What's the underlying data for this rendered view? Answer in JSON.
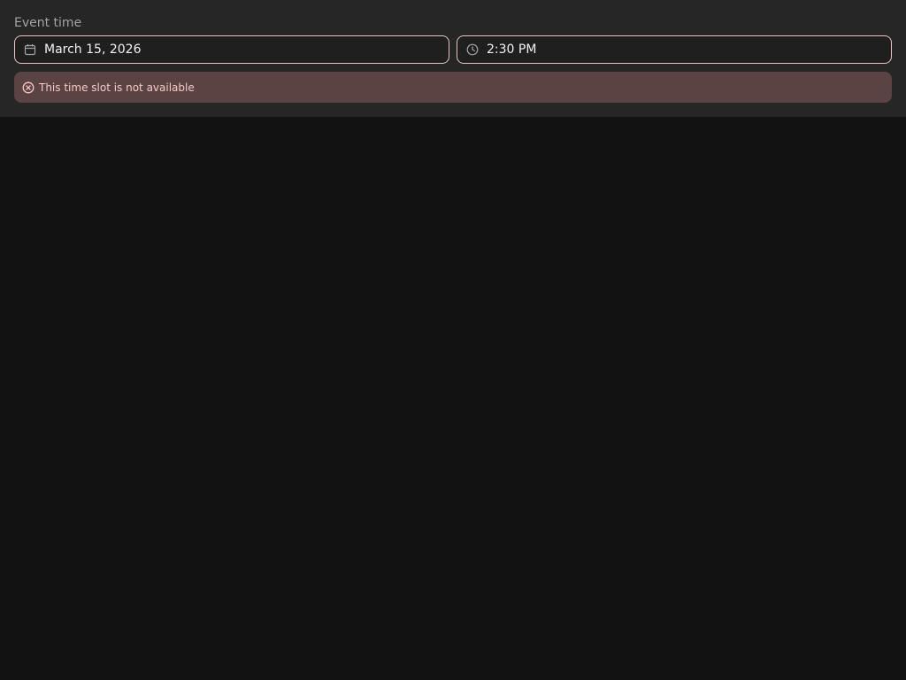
{
  "field": {
    "label": "Event time"
  },
  "date_input": {
    "value": "March 15, 2026",
    "icon": "calendar-icon"
  },
  "time_input": {
    "value": "2:30 PM",
    "icon": "clock-icon"
  },
  "error": {
    "message": "This time slot is not available",
    "icon": "error-circle-x-icon"
  },
  "colors": {
    "background": "#121212",
    "panel": "#262626",
    "input_border": "#e8c4c4",
    "error_bg": "#5c4343",
    "error_text": "#f5c9c9"
  }
}
